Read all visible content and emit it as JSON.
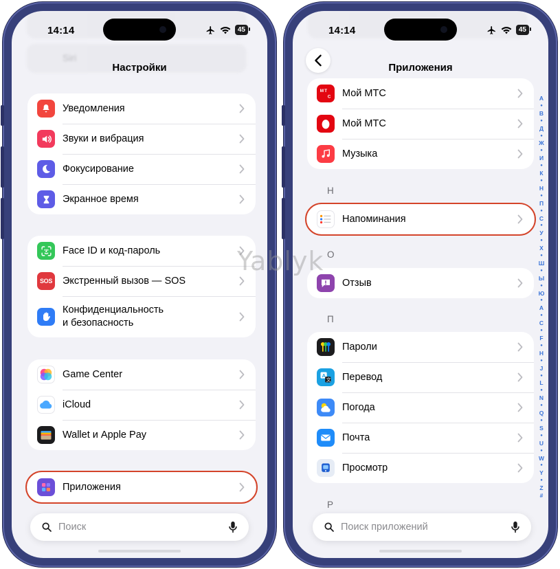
{
  "status": {
    "time": "14:14",
    "battery": "45"
  },
  "left": {
    "nav_title": "Настройки",
    "faded_top": "Siri",
    "groups": [
      [
        {
          "label": "Уведомления",
          "icon": "bell-icon",
          "color": "#f2463e"
        },
        {
          "label": "Звуки и вибрация",
          "icon": "speaker-icon",
          "color": "#f23a5c"
        },
        {
          "label": "Фокусирование",
          "icon": "moon-icon",
          "color": "#5e5ce6"
        },
        {
          "label": "Экранное время",
          "icon": "hourglass-icon",
          "color": "#5e5ce6"
        }
      ],
      [
        {
          "label": "Face ID и код-пароль",
          "icon": "faceid-icon",
          "color": "#34c759"
        },
        {
          "label": "Экстренный вызов — SOS",
          "icon": "sos-icon",
          "color": "#e0383e"
        },
        {
          "label": "Конфиденциальность\nи безопасность",
          "icon": "hand-icon",
          "color": "#2f7cf6"
        }
      ],
      [
        {
          "label": "Game Center",
          "icon": "gamecenter-icon",
          "color": "#ffffff"
        },
        {
          "label": "iCloud",
          "icon": "cloud-icon",
          "color": "#ffffff"
        },
        {
          "label": "Wallet и Apple Pay",
          "icon": "wallet-icon",
          "color": "#1c1c1e"
        }
      ],
      [
        {
          "label": "Приложения",
          "icon": "apps-grid-icon",
          "color": "#6b4fd8"
        }
      ]
    ],
    "search_placeholder": "Поиск"
  },
  "right": {
    "nav_title": "Приложения",
    "groups": [
      {
        "letter": "",
        "rows": [
          {
            "label": "Мой МТС",
            "icon": "mts-icon",
            "color": "#e30611"
          },
          {
            "label": "Мой МТС",
            "icon": "mts-egg-icon",
            "color": "#e30611"
          },
          {
            "label": "Музыка",
            "icon": "music-icon",
            "color": "#fc3c44"
          }
        ]
      },
      {
        "letter": "Н",
        "rows": [
          {
            "label": "Напоминания",
            "icon": "reminders-icon",
            "color": "#ffffff"
          }
        ]
      },
      {
        "letter": "О",
        "rows": [
          {
            "label": "Отзыв",
            "icon": "feedback-icon",
            "color": "#8e44ad"
          }
        ]
      },
      {
        "letter": "П",
        "rows": [
          {
            "label": "Пароли",
            "icon": "keys-icon",
            "color": "#1c1c1e"
          },
          {
            "label": "Перевод",
            "icon": "translate-icon",
            "color": "#1ba1e2"
          },
          {
            "label": "Погода",
            "icon": "weather-icon",
            "color": "#3d8af7"
          },
          {
            "label": "Почта",
            "icon": "mail-icon",
            "color": "#1f8cf9"
          },
          {
            "label": "Просмотр",
            "icon": "preview-icon",
            "color": "#e6ecf5"
          }
        ]
      },
      {
        "letter": "Р",
        "rows": []
      }
    ],
    "search_placeholder": "Поиск приложений",
    "index": [
      "А",
      "●",
      "В",
      "●",
      "Д",
      "●",
      "Ж",
      "●",
      "И",
      "●",
      "К",
      "●",
      "Н",
      "●",
      "П",
      "●",
      "С",
      "●",
      "У",
      "●",
      "Х",
      "●",
      "Ш",
      "●",
      "Ы",
      "●",
      "Ю",
      "●",
      "A",
      "●",
      "C",
      "●",
      "F",
      "●",
      "H",
      "●",
      "J",
      "●",
      "L",
      "●",
      "N",
      "●",
      "Q",
      "●",
      "S",
      "●",
      "U",
      "●",
      "W",
      "●",
      "Y",
      "●",
      "Z",
      "#"
    ]
  },
  "watermark": "Yablyk"
}
